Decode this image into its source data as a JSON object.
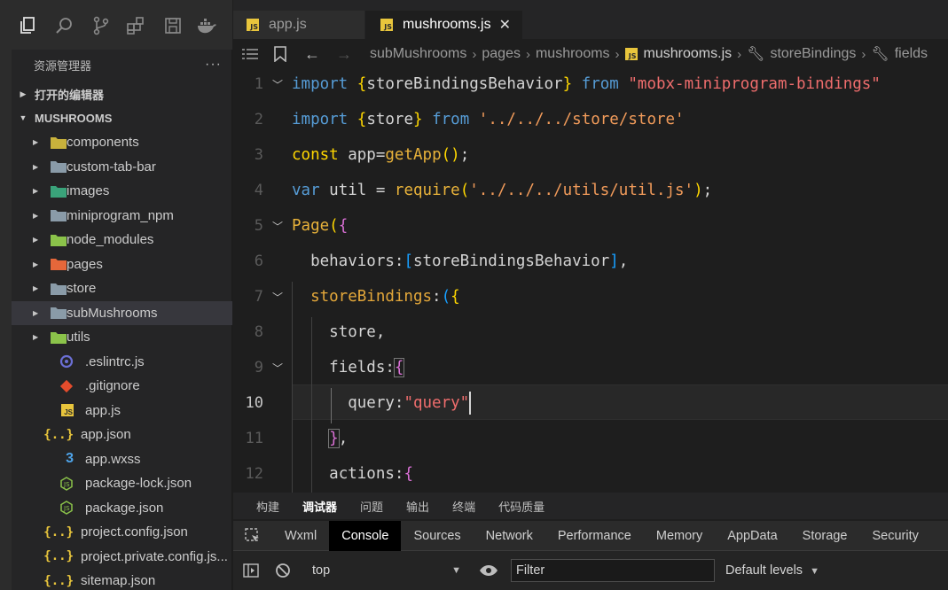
{
  "explorer": {
    "title": "资源管理器",
    "more": "···",
    "open_editors": "打开的编辑器",
    "root": "MUSHROOMS",
    "folders": [
      {
        "label": "components",
        "icon": "components-folder-icon",
        "color": "#c9b23c"
      },
      {
        "label": "custom-tab-bar",
        "icon": "folder-icon",
        "color": "#8a9ba8"
      },
      {
        "label": "images",
        "icon": "images-folder-icon",
        "color": "#3aa37a"
      },
      {
        "label": "miniprogram_npm",
        "icon": "folder-icon",
        "color": "#8a9ba8"
      },
      {
        "label": "node_modules",
        "icon": "node-folder-icon",
        "color": "#8bc34a"
      },
      {
        "label": "pages",
        "icon": "pages-folder-icon",
        "color": "#e5673a"
      },
      {
        "label": "store",
        "icon": "folder-icon",
        "color": "#8a9ba8"
      },
      {
        "label": "subMushrooms",
        "icon": "folder-icon",
        "color": "#8a9ba8"
      },
      {
        "label": "utils",
        "icon": "utils-folder-icon",
        "color": "#8bc34a"
      }
    ],
    "files": [
      {
        "label": ".eslintrc.js",
        "icon": "eslint-icon"
      },
      {
        "label": ".gitignore",
        "icon": "git-icon"
      },
      {
        "label": "app.js",
        "icon": "js-file-icon"
      },
      {
        "label": "app.json",
        "icon": "json-file-icon"
      },
      {
        "label": "app.wxss",
        "icon": "css-file-icon"
      },
      {
        "label": "package-lock.json",
        "icon": "node-json-icon"
      },
      {
        "label": "package.json",
        "icon": "node-json-icon"
      },
      {
        "label": "project.config.json",
        "icon": "json-file-icon"
      },
      {
        "label": "project.private.config.js...",
        "icon": "json-file-icon"
      },
      {
        "label": "sitemap.json",
        "icon": "json-file-icon"
      }
    ]
  },
  "tabs": [
    {
      "label": "app.js",
      "active": false
    },
    {
      "label": "mushrooms.js",
      "active": true,
      "close": "✕"
    }
  ],
  "breadcrumb": {
    "parts": [
      "subMushrooms",
      "pages",
      "mushrooms",
      "mushrooms.js",
      "storeBindings",
      "fields"
    ]
  },
  "editor": {
    "current_line": 10,
    "line_numbers": [
      "1",
      "2",
      "3",
      "4",
      "5",
      "6",
      "7",
      "8",
      "9",
      "10",
      "11",
      "12"
    ]
  },
  "panel": {
    "tabs": [
      "构建",
      "调试器",
      "问题",
      "输出",
      "终端",
      "代码质量"
    ],
    "selected": "调试器"
  },
  "devtools": {
    "tabs": [
      "Wxml",
      "Console",
      "Sources",
      "Network",
      "Performance",
      "Memory",
      "AppData",
      "Storage",
      "Security"
    ],
    "selected": "Console",
    "context": "top",
    "filter_placeholder": "Filter",
    "levels": "Default levels"
  }
}
